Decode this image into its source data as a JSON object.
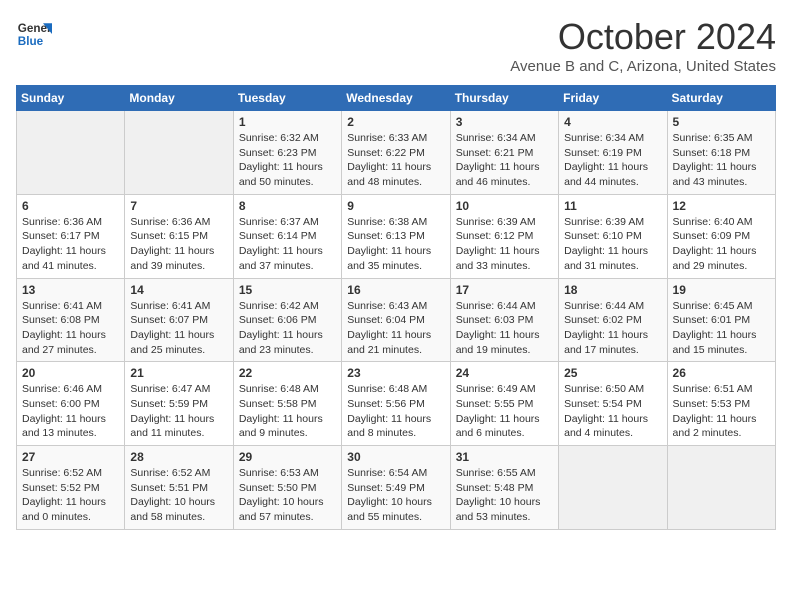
{
  "header": {
    "logo": {
      "text1": "General",
      "text2": "Blue"
    },
    "title": "October 2024",
    "location": "Avenue B and C, Arizona, United States"
  },
  "days_of_week": [
    "Sunday",
    "Monday",
    "Tuesday",
    "Wednesday",
    "Thursday",
    "Friday",
    "Saturday"
  ],
  "weeks": [
    [
      {
        "day": "",
        "info": ""
      },
      {
        "day": "",
        "info": ""
      },
      {
        "day": "1",
        "sunrise": "6:32 AM",
        "sunset": "6:23 PM",
        "daylight": "11 hours and 50 minutes."
      },
      {
        "day": "2",
        "sunrise": "6:33 AM",
        "sunset": "6:22 PM",
        "daylight": "11 hours and 48 minutes."
      },
      {
        "day": "3",
        "sunrise": "6:34 AM",
        "sunset": "6:21 PM",
        "daylight": "11 hours and 46 minutes."
      },
      {
        "day": "4",
        "sunrise": "6:34 AM",
        "sunset": "6:19 PM",
        "daylight": "11 hours and 44 minutes."
      },
      {
        "day": "5",
        "sunrise": "6:35 AM",
        "sunset": "6:18 PM",
        "daylight": "11 hours and 43 minutes."
      }
    ],
    [
      {
        "day": "6",
        "sunrise": "6:36 AM",
        "sunset": "6:17 PM",
        "daylight": "11 hours and 41 minutes."
      },
      {
        "day": "7",
        "sunrise": "6:36 AM",
        "sunset": "6:15 PM",
        "daylight": "11 hours and 39 minutes."
      },
      {
        "day": "8",
        "sunrise": "6:37 AM",
        "sunset": "6:14 PM",
        "daylight": "11 hours and 37 minutes."
      },
      {
        "day": "9",
        "sunrise": "6:38 AM",
        "sunset": "6:13 PM",
        "daylight": "11 hours and 35 minutes."
      },
      {
        "day": "10",
        "sunrise": "6:39 AM",
        "sunset": "6:12 PM",
        "daylight": "11 hours and 33 minutes."
      },
      {
        "day": "11",
        "sunrise": "6:39 AM",
        "sunset": "6:10 PM",
        "daylight": "11 hours and 31 minutes."
      },
      {
        "day": "12",
        "sunrise": "6:40 AM",
        "sunset": "6:09 PM",
        "daylight": "11 hours and 29 minutes."
      }
    ],
    [
      {
        "day": "13",
        "sunrise": "6:41 AM",
        "sunset": "6:08 PM",
        "daylight": "11 hours and 27 minutes."
      },
      {
        "day": "14",
        "sunrise": "6:41 AM",
        "sunset": "6:07 PM",
        "daylight": "11 hours and 25 minutes."
      },
      {
        "day": "15",
        "sunrise": "6:42 AM",
        "sunset": "6:06 PM",
        "daylight": "11 hours and 23 minutes."
      },
      {
        "day": "16",
        "sunrise": "6:43 AM",
        "sunset": "6:04 PM",
        "daylight": "11 hours and 21 minutes."
      },
      {
        "day": "17",
        "sunrise": "6:44 AM",
        "sunset": "6:03 PM",
        "daylight": "11 hours and 19 minutes."
      },
      {
        "day": "18",
        "sunrise": "6:44 AM",
        "sunset": "6:02 PM",
        "daylight": "11 hours and 17 minutes."
      },
      {
        "day": "19",
        "sunrise": "6:45 AM",
        "sunset": "6:01 PM",
        "daylight": "11 hours and 15 minutes."
      }
    ],
    [
      {
        "day": "20",
        "sunrise": "6:46 AM",
        "sunset": "6:00 PM",
        "daylight": "11 hours and 13 minutes."
      },
      {
        "day": "21",
        "sunrise": "6:47 AM",
        "sunset": "5:59 PM",
        "daylight": "11 hours and 11 minutes."
      },
      {
        "day": "22",
        "sunrise": "6:48 AM",
        "sunset": "5:58 PM",
        "daylight": "11 hours and 9 minutes."
      },
      {
        "day": "23",
        "sunrise": "6:48 AM",
        "sunset": "5:56 PM",
        "daylight": "11 hours and 8 minutes."
      },
      {
        "day": "24",
        "sunrise": "6:49 AM",
        "sunset": "5:55 PM",
        "daylight": "11 hours and 6 minutes."
      },
      {
        "day": "25",
        "sunrise": "6:50 AM",
        "sunset": "5:54 PM",
        "daylight": "11 hours and 4 minutes."
      },
      {
        "day": "26",
        "sunrise": "6:51 AM",
        "sunset": "5:53 PM",
        "daylight": "11 hours and 2 minutes."
      }
    ],
    [
      {
        "day": "27",
        "sunrise": "6:52 AM",
        "sunset": "5:52 PM",
        "daylight": "11 hours and 0 minutes."
      },
      {
        "day": "28",
        "sunrise": "6:52 AM",
        "sunset": "5:51 PM",
        "daylight": "10 hours and 58 minutes."
      },
      {
        "day": "29",
        "sunrise": "6:53 AM",
        "sunset": "5:50 PM",
        "daylight": "10 hours and 57 minutes."
      },
      {
        "day": "30",
        "sunrise": "6:54 AM",
        "sunset": "5:49 PM",
        "daylight": "10 hours and 55 minutes."
      },
      {
        "day": "31",
        "sunrise": "6:55 AM",
        "sunset": "5:48 PM",
        "daylight": "10 hours and 53 minutes."
      },
      {
        "day": "",
        "info": ""
      },
      {
        "day": "",
        "info": ""
      }
    ]
  ],
  "labels": {
    "sunrise": "Sunrise:",
    "sunset": "Sunset:",
    "daylight": "Daylight:"
  }
}
